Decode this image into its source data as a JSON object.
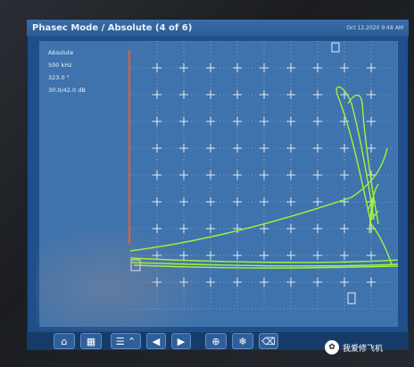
{
  "window": {
    "title": "Phasec Mode / Absolute  (4 of 6)",
    "datetime": "Oct 12,2020  9:48 AM"
  },
  "readout": {
    "mode": "Absolute",
    "frequency": "500 kHz",
    "phase": "323.0 °",
    "gain": "30.0/42.0 dB"
  },
  "toolbar": {
    "buttons": [
      {
        "icon": "home-icon",
        "glyph": "⌂"
      },
      {
        "icon": "grid-icon",
        "glyph": "▦"
      },
      {
        "icon": "menu-up-icon",
        "glyph": "☰ ⌃"
      },
      {
        "icon": "arrow-left-icon",
        "glyph": "◀"
      },
      {
        "icon": "arrow-right-icon",
        "glyph": "▶"
      },
      {
        "icon": "crosshair-icon",
        "glyph": "⊕"
      },
      {
        "icon": "snowflake-freeze-icon",
        "glyph": "❄"
      },
      {
        "icon": "eraser-icon",
        "glyph": "⌫"
      }
    ]
  },
  "watermark": {
    "text": "我爱修飞机",
    "badge": "✿"
  },
  "colors": {
    "signal": "#a6f23a",
    "plot_bg": "#3f73ad",
    "grid": "#cfe0f2",
    "left_marker": "#ff5a1f"
  }
}
